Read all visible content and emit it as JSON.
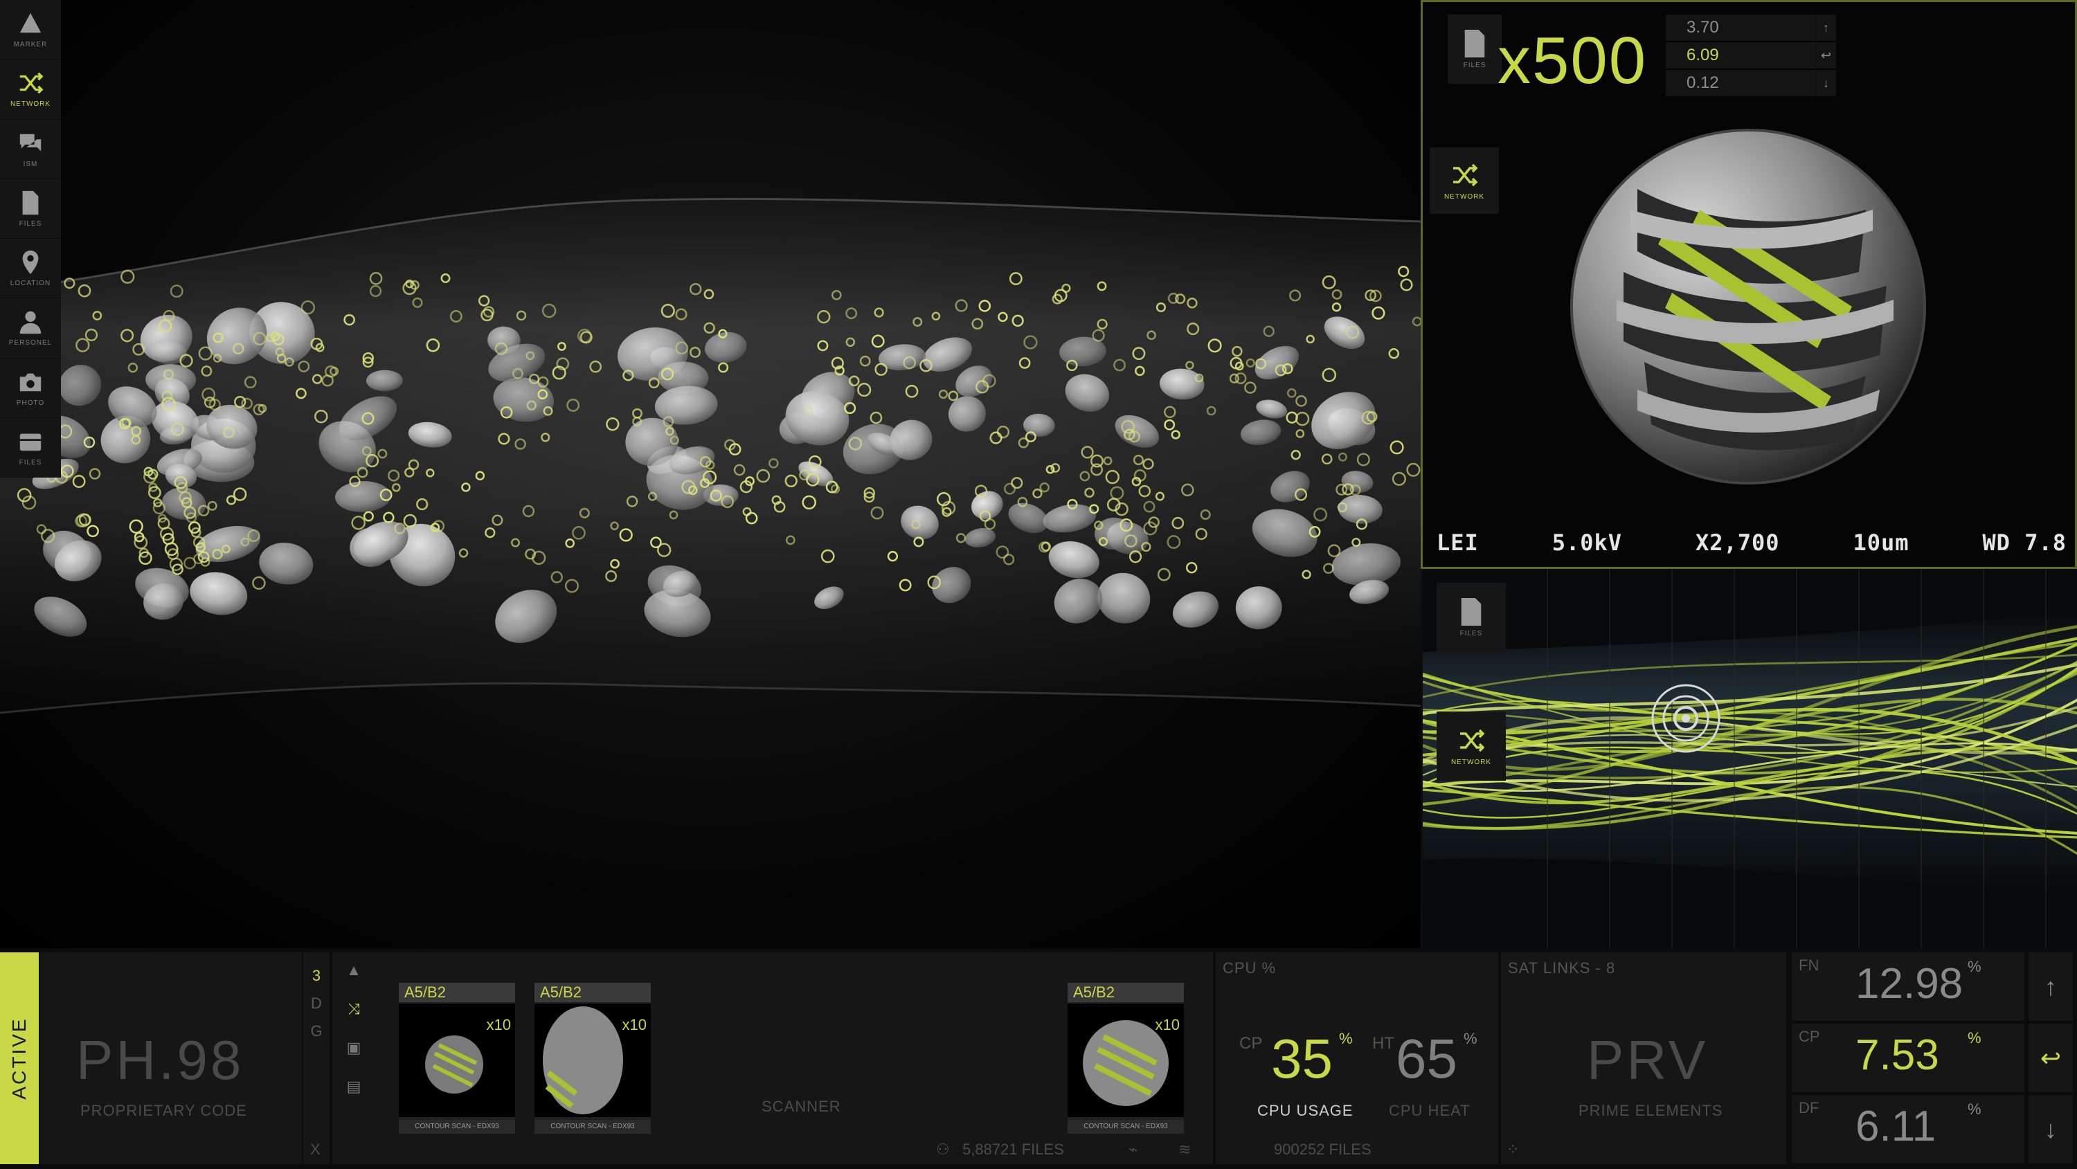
{
  "left_toolbar": [
    {
      "key": "marker",
      "label": "MARKER",
      "active": false
    },
    {
      "key": "network",
      "label": "NETWORK",
      "active": true
    },
    {
      "key": "ism",
      "label": "ISM",
      "active": false
    },
    {
      "key": "files",
      "label": "FILES",
      "active": false
    },
    {
      "key": "location",
      "label": "LOCATION",
      "active": false
    },
    {
      "key": "personel",
      "label": "PERSONEL",
      "active": false
    },
    {
      "key": "photo",
      "label": "PHOTO",
      "active": false
    },
    {
      "key": "files2",
      "label": "FILES",
      "active": false
    }
  ],
  "right_toolbar": [
    {
      "key": "marker",
      "label": "MARKER",
      "active": false
    },
    {
      "key": "network",
      "label": "NETWORK",
      "active": true
    },
    {
      "key": "ism",
      "label": "ISM",
      "active": false
    },
    {
      "key": "files",
      "label": "FILES",
      "active": false
    },
    {
      "key": "location",
      "label": "LOCATION",
      "active": false
    },
    {
      "key": "personel",
      "label": "PERSONEL",
      "active": false
    },
    {
      "key": "photo",
      "label": "PHOTO",
      "active": false
    },
    {
      "key": "files2",
      "label": "FILES",
      "active": false
    }
  ],
  "sem": {
    "files_label": "FILES",
    "network_label": "NETWORK",
    "zoom": "x500",
    "coords": [
      {
        "value": "3.70",
        "btn": "↑",
        "highlight": false
      },
      {
        "value": "6.09",
        "btn": "↩",
        "highlight": true
      },
      {
        "value": "0.12",
        "btn": "↓",
        "highlight": false
      }
    ],
    "readout": [
      "LEI",
      "5.0kV",
      "X2,700",
      "10um",
      "WD 7.8"
    ]
  },
  "nerve": {
    "files_label": "FILES",
    "network_label": "NETWORK"
  },
  "bottom": {
    "active_label": "ACTIVE",
    "code": {
      "value": "PH.98",
      "label": "PROPRIETARY CODE"
    },
    "mini_col": [
      "3",
      "D",
      "G"
    ],
    "mini_close": "X",
    "thumbs": [
      {
        "title": "A5/B2",
        "zoom": "x10",
        "caption": "CONTOUR SCAN - EDX93"
      },
      {
        "title": "A5/B2",
        "zoom": "x10",
        "caption": "CONTOUR SCAN - EDX93"
      },
      {
        "title": "A5/B2",
        "zoom": "x10",
        "caption": "CONTOUR SCAN - EDX93"
      }
    ],
    "scanner_label": "SCANNER",
    "files_count": "5,88721 FILES",
    "cpu": {
      "title": "CPU %",
      "cp_prefix": "CP",
      "cp_value": "35",
      "cp_unit": "%",
      "cp_label": "CPU USAGE",
      "ht_prefix": "HT",
      "ht_value": "65",
      "ht_unit": "%",
      "ht_label": "CPU HEAT",
      "files": "900252 FILES"
    },
    "sat": {
      "title": "SAT LINKS - 8",
      "value": "PRV",
      "label": "PRIME ELEMENTS"
    },
    "stats": [
      {
        "prefix": "FN",
        "value": "12.98",
        "unit": "%",
        "btn": "↑",
        "highlight": false
      },
      {
        "prefix": "CP",
        "value": "7.53",
        "unit": "%",
        "btn": "↩",
        "highlight": true
      },
      {
        "prefix": "DF",
        "value": "6.11",
        "unit": "%",
        "btn": "↓",
        "highlight": false
      }
    ]
  },
  "colors": {
    "accent": "#c7d946",
    "panel": "#161616",
    "background": "#000000"
  }
}
